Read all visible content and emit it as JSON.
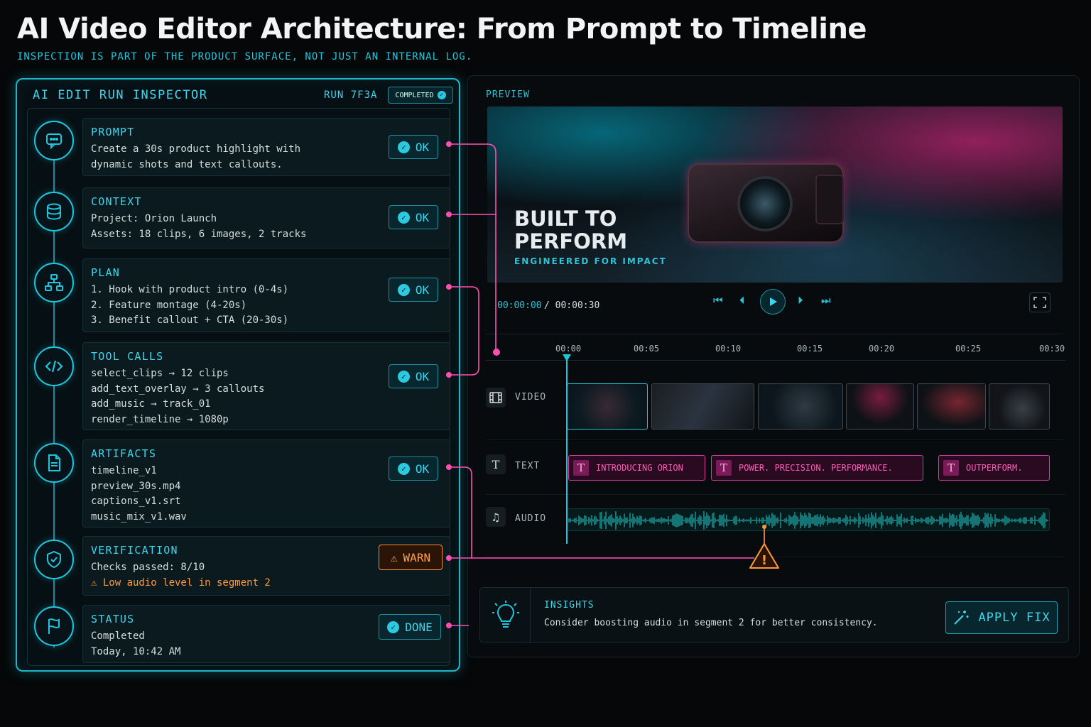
{
  "header": {
    "title": "AI Video Editor Architecture: From Prompt to Timeline",
    "subtitle": "INSPECTION IS PART OF THE PRODUCT SURFACE, NOT JUST AN INTERNAL LOG."
  },
  "inspector": {
    "title": "AI EDIT RUN INSPECTOR",
    "run_id": "RUN 7F3A",
    "run_status": "COMPLETED",
    "stages": [
      {
        "name": "PROMPT",
        "icon": "chat-icon",
        "lines": [
          "Create a 30s product highlight with",
          "dynamic shots and text callouts."
        ],
        "badge": "OK"
      },
      {
        "name": "CONTEXT",
        "icon": "database-icon",
        "lines": [
          "Project: Orion Launch",
          "Assets: 18 clips, 6 images, 2 tracks"
        ],
        "badge": "OK"
      },
      {
        "name": "PLAN",
        "icon": "hierarchy-icon",
        "lines": [
          "1. Hook with product intro (0-4s)",
          "2. Feature montage (4-20s)",
          "3. Benefit callout + CTA (20-30s)"
        ],
        "badge": "OK"
      },
      {
        "name": "TOOL CALLS",
        "icon": "code-icon",
        "lines": [
          "select_clips → 12 clips",
          "add_text_overlay  →  3 callouts",
          "add_music  →  track_01",
          "render_timeline  →  1080p"
        ],
        "badge": "OK"
      },
      {
        "name": "ARTIFACTS",
        "icon": "document-icon",
        "lines": [
          "timeline_v1",
          "preview_30s.mp4",
          "captions_v1.srt",
          "music_mix_v1.wav"
        ],
        "badge": "OK"
      },
      {
        "name": "VERIFICATION",
        "icon": "shield-check-icon",
        "lines": [
          "Checks passed: 8/10"
        ],
        "warning": "Low audio level in segment 2",
        "badge": "WARN"
      },
      {
        "name": "STATUS",
        "icon": "flag-icon",
        "lines": [
          "Completed",
          "Today, 10:42 AM"
        ],
        "badge": "DONE"
      }
    ]
  },
  "preview": {
    "label": "PREVIEW",
    "headline_line1": "BUILT TO",
    "headline_line2": "PERFORM",
    "tagline": "ENGINEERED FOR IMPACT",
    "time_current": "00:00:00",
    "time_total": "/ 00:00:30"
  },
  "timeline": {
    "ticks": [
      "00:00",
      "00:05",
      "00:10",
      "00:15",
      "00:20",
      "00:25",
      "00:30"
    ],
    "tracks": {
      "video": "VIDEO",
      "text": "TEXT",
      "audio": "AUDIO"
    },
    "text_clips": [
      "INTRODUCING ORION",
      "POWER. PRECISION. PERFORMANCE.",
      "OUTPERFORM."
    ],
    "video_clip_count": 6
  },
  "insights": {
    "title": "INSIGHTS",
    "text": "Consider boosting audio in segment 2 for better consistency.",
    "button": "APPLY FIX"
  },
  "colors": {
    "accent": "#1fc7de",
    "connector": "#ff4fb2",
    "warning": "#ff9a3c",
    "text_clip": "#ff5ab8"
  }
}
